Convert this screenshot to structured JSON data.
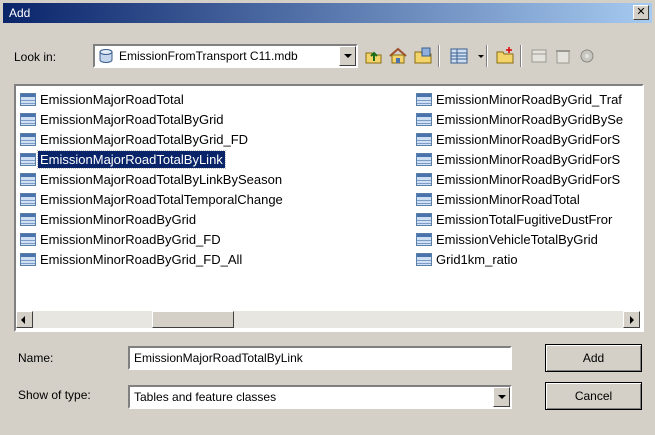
{
  "window": {
    "title": "Add",
    "close_glyph": "✕"
  },
  "lookin": {
    "label": "Look in:",
    "value": "EmissionFromTransport C11.mdb",
    "icon": "database-icon"
  },
  "toolbar": [
    {
      "name": "up-one-level-icon"
    },
    {
      "name": "home-icon"
    },
    {
      "name": "connect-folder-icon"
    },
    {
      "name": "view-list-icon"
    },
    {
      "name": "new-folder-icon"
    },
    {
      "name": "catalog-icon"
    },
    {
      "name": "delete-icon"
    },
    {
      "name": "properties-icon"
    }
  ],
  "list": {
    "col1": [
      "EmissionMajorRoadTotal",
      "EmissionMajorRoadTotalByGrid",
      "EmissionMajorRoadTotalByGrid_FD",
      "EmissionMajorRoadTotalByLink",
      "EmissionMajorRoadTotalByLinkBySeason",
      "EmissionMajorRoadTotalTemporalChange",
      "EmissionMinorRoadByGrid",
      "EmissionMinorRoadByGrid_FD",
      "EmissionMinorRoadByGrid_FD_All"
    ],
    "col2": [
      "EmissionMinorRoadByGrid_Traf",
      "EmissionMinorRoadByGridBySe",
      "EmissionMinorRoadByGridForS",
      "EmissionMinorRoadByGridForS",
      "EmissionMinorRoadByGridForS",
      "EmissionMinorRoadTotal",
      "EmissionTotalFugitiveDustFror",
      "EmissionVehicleTotalByGrid",
      "Grid1km_ratio"
    ],
    "selected": "EmissionMajorRoadTotalByLink"
  },
  "form": {
    "name_label": "Name:",
    "name_value": "EmissionMajorRoadTotalByLink",
    "type_label": "Show of type:",
    "type_value": "Tables and feature classes"
  },
  "buttons": {
    "add": "Add",
    "cancel": "Cancel"
  }
}
